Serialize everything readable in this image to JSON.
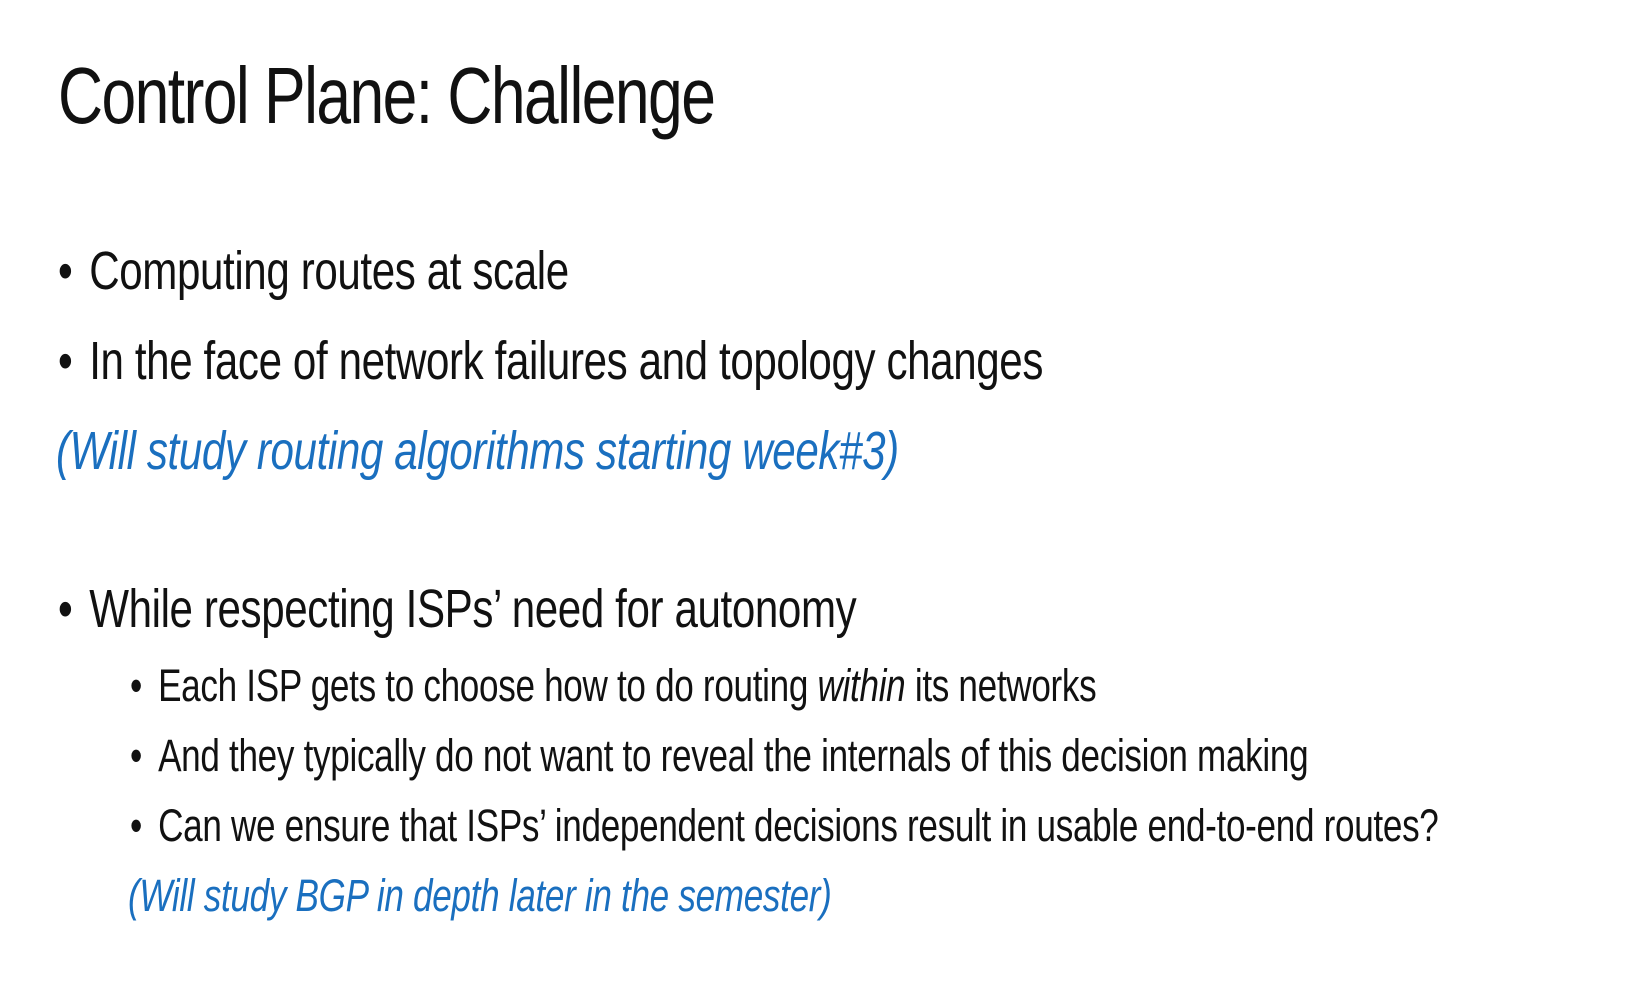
{
  "title": "Control Plane: Challenge",
  "bullet_glyph": "•",
  "items": [
    {
      "text": "Computing routes at scale"
    },
    {
      "text": "In the face of network failures and topology changes"
    },
    {
      "text": "While respecting ISPs’ need for autonomy"
    }
  ],
  "note1": "(Will study routing algorithms starting week#3)",
  "subitems": [
    {
      "before": "Each ISP gets to choose how to do routing ",
      "emph": "within",
      "after": " its networks"
    },
    {
      "text": "And they typically do not want to reveal the internals of this decision making"
    },
    {
      "text": "Can we ensure that ISPs’ independent decisions result in usable end-to-end routes?"
    }
  ],
  "note2": "(Will study BGP in depth later in the semester)",
  "colors": {
    "text": "#111111",
    "note": "#1a6fbf",
    "background": "#ffffff"
  }
}
